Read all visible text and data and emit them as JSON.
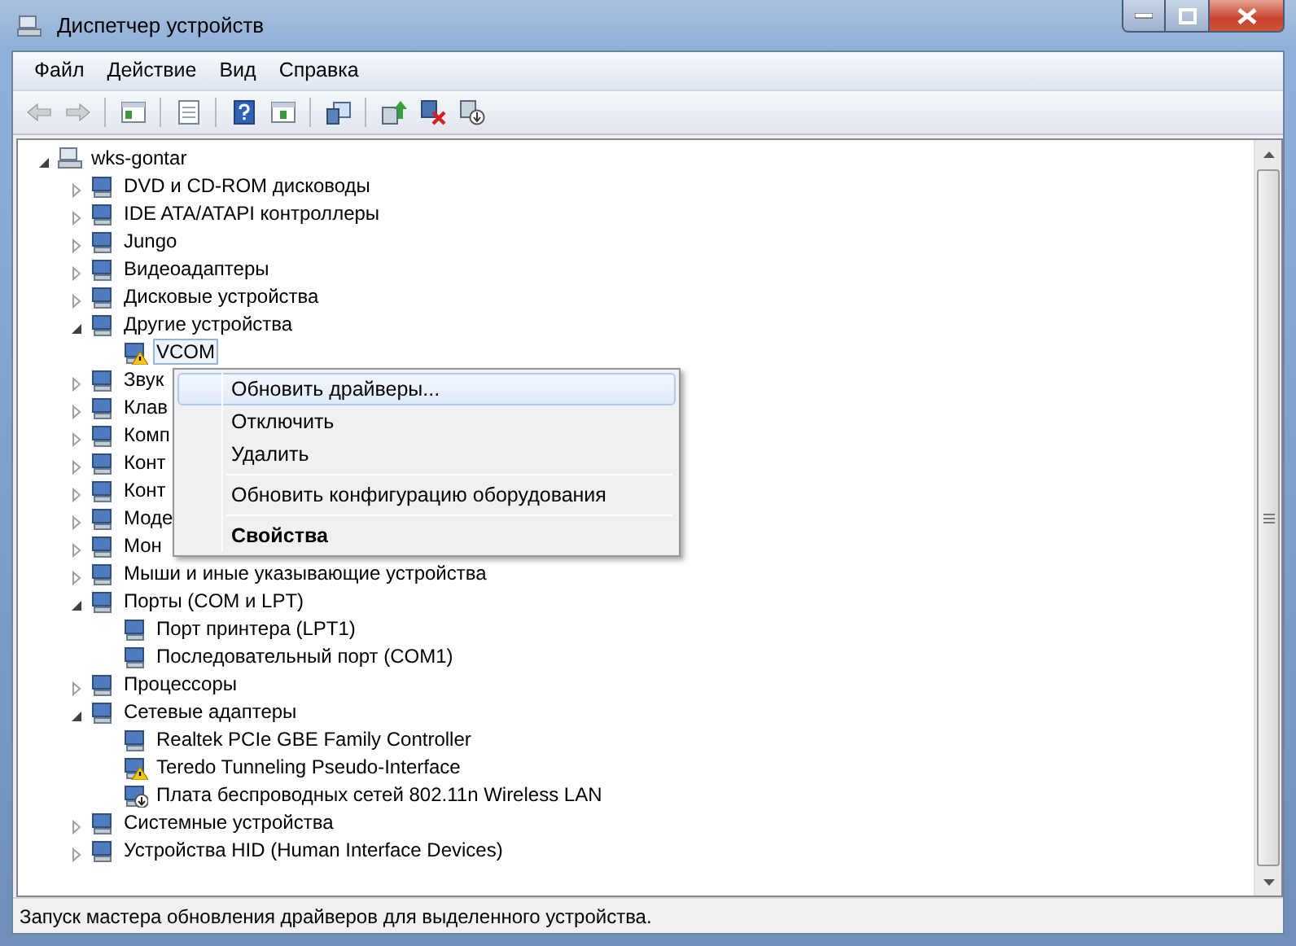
{
  "window": {
    "title": "Диспетчер устройств"
  },
  "menu_bar": [
    "Файл",
    "Действие",
    "Вид",
    "Справка"
  ],
  "toolbar": [
    {
      "kind": "back",
      "disabled": true
    },
    {
      "kind": "forward",
      "disabled": true
    },
    {
      "kind": "separator"
    },
    {
      "kind": "tree",
      "disabled": false
    },
    {
      "kind": "separator"
    },
    {
      "kind": "properties",
      "disabled": false
    },
    {
      "kind": "separator"
    },
    {
      "kind": "help",
      "disabled": false
    },
    {
      "kind": "view",
      "disabled": false
    },
    {
      "kind": "separator"
    },
    {
      "kind": "scan",
      "disabled": false
    },
    {
      "kind": "separator"
    },
    {
      "kind": "update",
      "disabled": false
    },
    {
      "kind": "uninstall",
      "disabled": false
    },
    {
      "kind": "disable",
      "disabled": false
    }
  ],
  "tree": {
    "label": "wks-gontar",
    "expanded": true,
    "selected": false,
    "children": [
      {
        "label": "DVD и CD-ROM дисководы",
        "expanded": false,
        "selected": false
      },
      {
        "label": "IDE ATA/ATAPI контроллеры",
        "expanded": false,
        "selected": false
      },
      {
        "label": "Jungo",
        "expanded": false,
        "selected": false
      },
      {
        "label": "Видеоадаптеры",
        "expanded": false,
        "selected": false
      },
      {
        "label": "Дисковые устройства",
        "expanded": false,
        "selected": false
      },
      {
        "label": "Другие устройства",
        "expanded": true,
        "selected": false,
        "children": [
          {
            "label": "VCOM",
            "selected": true,
            "warning": true,
            "disabled": false
          }
        ]
      },
      {
        "label": "Звук",
        "expanded": false,
        "selected": false
      },
      {
        "label": "Клав",
        "expanded": false,
        "selected": false
      },
      {
        "label": "Комп",
        "expanded": false,
        "selected": false
      },
      {
        "label": "Конт",
        "expanded": false,
        "selected": false
      },
      {
        "label": "Конт",
        "expanded": false,
        "selected": false
      },
      {
        "label": "Моде",
        "expanded": false,
        "selected": false
      },
      {
        "label": "Мон",
        "expanded": false,
        "selected": false
      },
      {
        "label": "Мыши и иные указывающие устройства",
        "expanded": false,
        "selected": false
      },
      {
        "label": "Порты (COM и LPT)",
        "expanded": true,
        "selected": false,
        "children": [
          {
            "label": "Порт принтера (LPT1)",
            "selected": false,
            "warning": false,
            "disabled": false
          },
          {
            "label": "Последовательный порт (COM1)",
            "selected": false,
            "warning": false,
            "disabled": false
          }
        ]
      },
      {
        "label": "Процессоры",
        "expanded": false,
        "selected": false
      },
      {
        "label": "Сетевые адаптеры",
        "expanded": true,
        "selected": false,
        "children": [
          {
            "label": "Realtek PCIe GBE Family Controller",
            "selected": false,
            "warning": false,
            "disabled": false
          },
          {
            "label": "Teredo Tunneling Pseudo-Interface",
            "selected": false,
            "warning": true,
            "disabled": false
          },
          {
            "label": "Плата беспроводных сетей 802.11n Wireless LAN",
            "selected": false,
            "warning": false,
            "disabled": true
          }
        ]
      },
      {
        "label": "Системные устройства",
        "expanded": false,
        "selected": false
      },
      {
        "label": "Устройства HID (Human Interface Devices)",
        "expanded": false,
        "selected": false
      }
    ]
  },
  "context_menu": [
    {
      "kind": "item",
      "label": "Обновить драйверы...",
      "selected": true,
      "default": false
    },
    {
      "kind": "item",
      "label": "Отключить",
      "selected": false,
      "default": false
    },
    {
      "kind": "item",
      "label": "Удалить",
      "selected": false,
      "default": false
    },
    {
      "kind": "separator"
    },
    {
      "kind": "item",
      "label": "Обновить конфигурацию оборудования",
      "selected": false,
      "default": false
    },
    {
      "kind": "separator"
    },
    {
      "kind": "item",
      "label": "Свойства",
      "selected": false,
      "default": true
    }
  ],
  "status_bar": {
    "text": "Запуск мастера обновления драйверов для выделенного устройства."
  }
}
